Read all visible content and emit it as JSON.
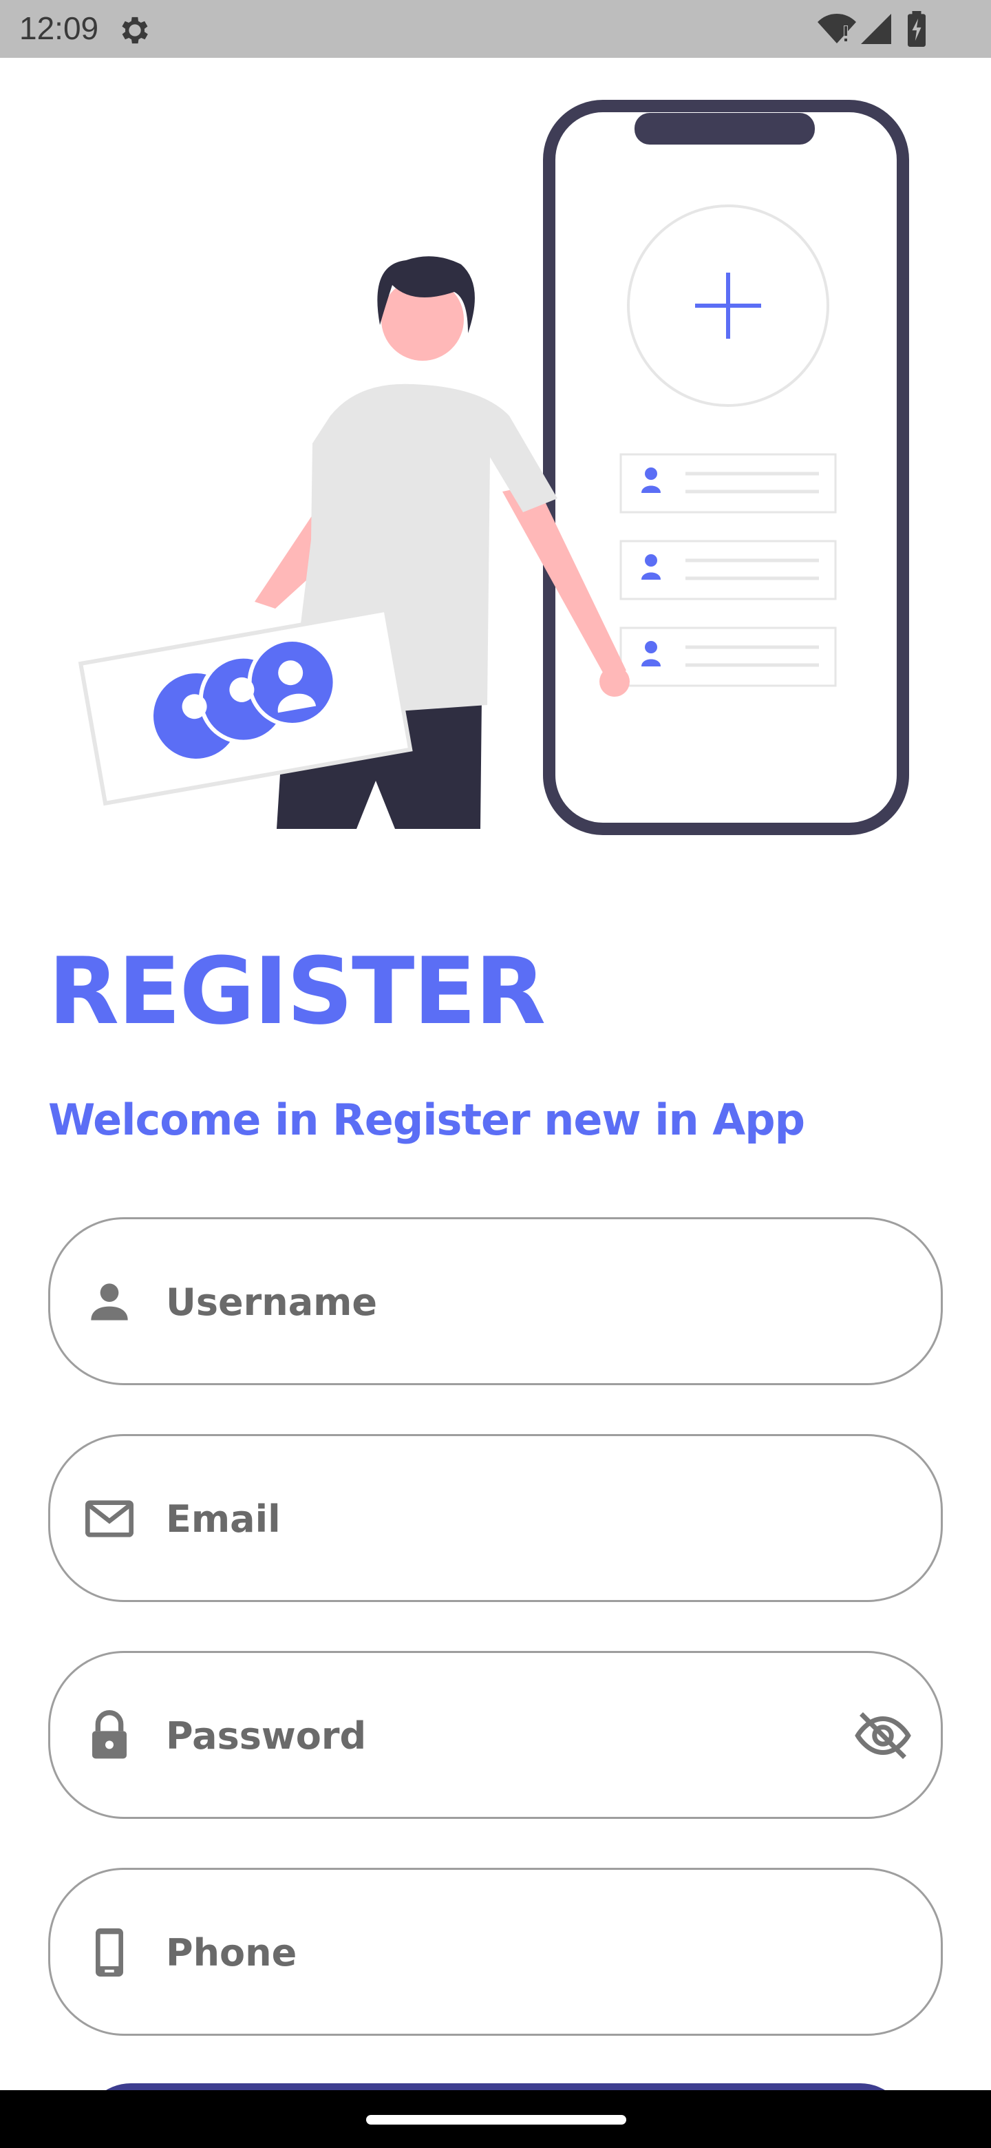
{
  "status_bar": {
    "time": "12:09",
    "icons": [
      "gear-icon",
      "wifi-icon",
      "signal-icon",
      "battery-charging-icon"
    ]
  },
  "illustration": {
    "description_icon": "person-holding-card-with-phone-illustration",
    "accent_color": "#5b6ef5"
  },
  "page": {
    "title": "REGISTER",
    "subtitle": "Welcome in Register new in App"
  },
  "form": {
    "username": {
      "placeholder": "Username",
      "value": "",
      "icon": "person-icon"
    },
    "email": {
      "placeholder": "Email",
      "value": "",
      "icon": "mail-icon"
    },
    "password": {
      "placeholder": "Password",
      "value": "",
      "icon": "lock-icon",
      "toggle_icon": "eye-off-icon"
    },
    "phone": {
      "placeholder": "Phone",
      "value": "",
      "icon": "phone-icon"
    }
  },
  "colors": {
    "accent": "#5b6ef5",
    "field_border": "#9e9e9e",
    "button": "#3d3d8f"
  }
}
